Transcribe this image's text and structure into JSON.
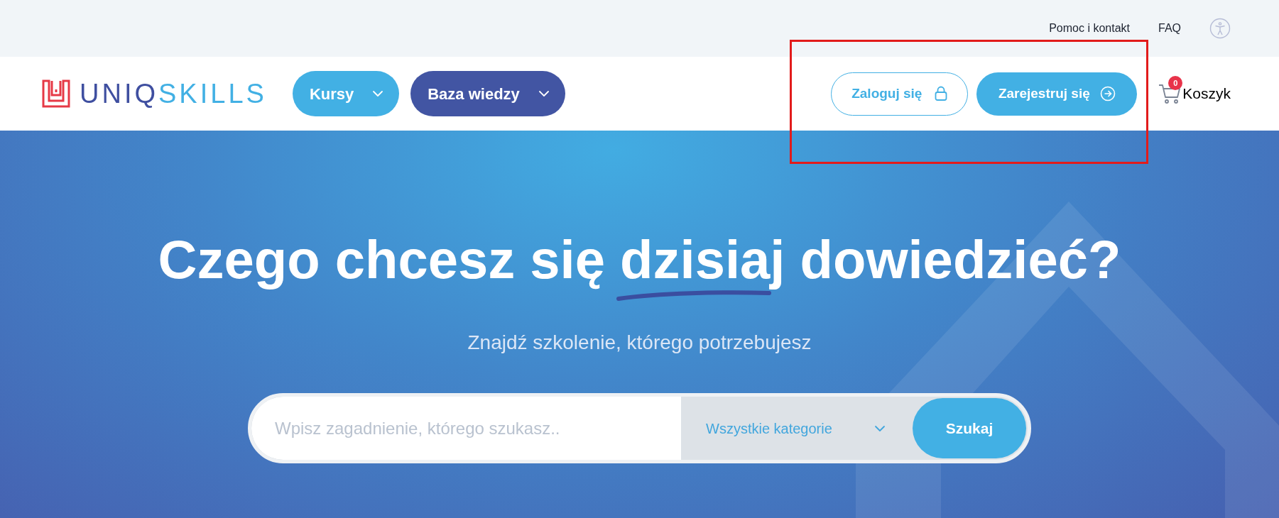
{
  "top_bar": {
    "links": [
      "Pomoc i kontakt",
      "FAQ"
    ]
  },
  "header": {
    "logo": {
      "first": "UNIQ",
      "second": "SKILLS"
    },
    "nav": [
      {
        "label": "Kursy",
        "color": "#42b0e4"
      },
      {
        "label": "Baza wiedzy",
        "color": "#4255a3"
      }
    ],
    "login_button": "Zaloguj się",
    "register_button": "Zarejestruj się",
    "cart": {
      "label": "Koszyk",
      "count": "0"
    }
  },
  "hero": {
    "title_before": "Czego chcesz się ",
    "title_underlined": "dzisiaj",
    "title_after": " dowiedzieć?",
    "subtitle": "Znajdź szkolenie, którego potrzebujesz",
    "search": {
      "placeholder": "Wpisz zagadnienie, którego szukasz..",
      "category": "Wszystkie kategorie",
      "button": "Szukaj"
    }
  }
}
